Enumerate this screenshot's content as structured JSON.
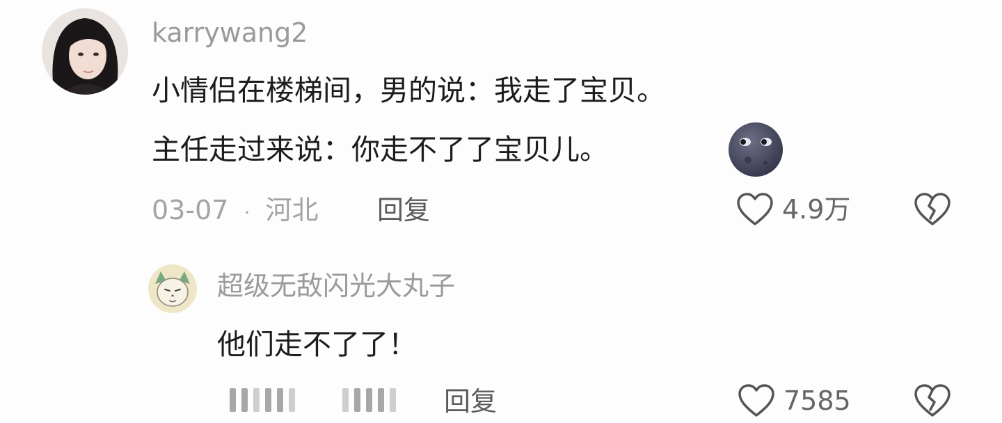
{
  "comment": {
    "username": "karrywang2",
    "lines": [
      "小情侣在楼梯间，男的说：我走了宝贝。",
      "主任走过来说：你走不了了宝贝儿。"
    ],
    "emoji_icon": "new-moon-face-icon",
    "date": "03-07",
    "separator": "·",
    "location": "河北",
    "reply_label": "回复",
    "like_count": "4.9万"
  },
  "reply": {
    "username": "超级无敌闪光大丸子",
    "text": "他们走不了了！",
    "reply_label": "回复",
    "like_count": "7585"
  },
  "colors": {
    "username": "#9a9a9a",
    "text": "#1c1c1c",
    "meta": "#a3a3a3",
    "icon_stroke": "#555555"
  }
}
